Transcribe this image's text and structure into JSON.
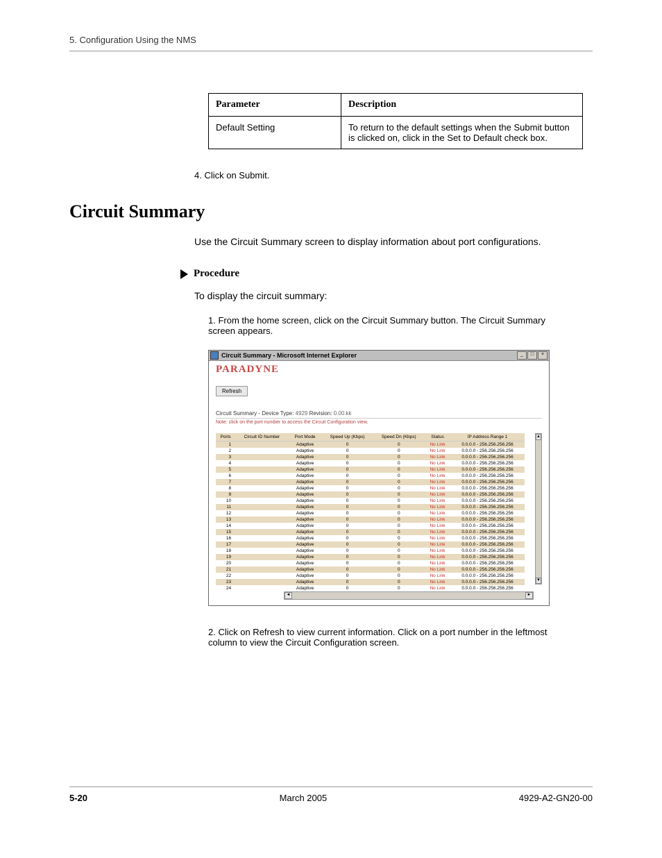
{
  "header": {
    "section": "5.  Configuration Using the NMS"
  },
  "param_table": {
    "h1": "Parameter",
    "h2": "Description",
    "r1c1": "Default Setting",
    "r1c2": "To return to the default settings when the Submit button is clicked on, click in the Set to Default check box."
  },
  "step4": "4.  Click on Submit.",
  "section_title": "Circuit Summary",
  "intro": "Use the Circuit Summary screen to display information about port configurations.",
  "procedure_label": "Procedure",
  "proc_intro": "To display the circuit summary:",
  "step1": "1.  From the home screen, click on the Circuit Summary button. The Circuit Summary screen appears.",
  "screenshot": {
    "title": "Circuit Summary - Microsoft Internet Explorer",
    "brand": "PARADYNE",
    "refresh": "Refresh",
    "device_prefix": "Circuit Summary - Device Type: ",
    "device_type": "4929",
    "rev_prefix": "    Revision: ",
    "revision": "0.00.kk",
    "note": "Note: click on the port number to access the Circuit Configuration view.",
    "columns": [
      "Ports",
      "Circuit ID Number",
      "Port Mode",
      "Speed Up (Kbps)",
      "Speed Dn (Kbps)",
      "Status",
      "IP Address Range 1"
    ],
    "rows": [
      {
        "port": "1",
        "mode": "Adaptive",
        "up": "0",
        "dn": "0",
        "status": "No Link",
        "ip": "0.0.0.0 - 256.256.256.256"
      },
      {
        "port": "2",
        "mode": "Adaptive",
        "up": "0",
        "dn": "0",
        "status": "No Link",
        "ip": "0.0.0.0 - 256.256.256.256"
      },
      {
        "port": "3",
        "mode": "Adaptive",
        "up": "0",
        "dn": "0",
        "status": "No Link",
        "ip": "0.0.0.0 - 256.256.256.256"
      },
      {
        "port": "4",
        "mode": "Adaptive",
        "up": "0",
        "dn": "0",
        "status": "No Link",
        "ip": "0.0.0.0 - 256.256.256.256"
      },
      {
        "port": "5",
        "mode": "Adaptive",
        "up": "0",
        "dn": "0",
        "status": "No Link",
        "ip": "0.0.0.0 - 256.256.256.256"
      },
      {
        "port": "6",
        "mode": "Adaptive",
        "up": "0",
        "dn": "0",
        "status": "No Link",
        "ip": "0.0.0.0 - 256.256.256.256"
      },
      {
        "port": "7",
        "mode": "Adaptive",
        "up": "0",
        "dn": "0",
        "status": "No Link",
        "ip": "0.0.0.0 - 256.256.256.256"
      },
      {
        "port": "8",
        "mode": "Adaptive",
        "up": "0",
        "dn": "0",
        "status": "No Link",
        "ip": "0.0.0.0 - 256.256.256.256"
      },
      {
        "port": "9",
        "mode": "Adaptive",
        "up": "0",
        "dn": "0",
        "status": "No Link",
        "ip": "0.0.0.0 - 256.256.256.256"
      },
      {
        "port": "10",
        "mode": "Adaptive",
        "up": "0",
        "dn": "0",
        "status": "No Link",
        "ip": "0.0.0.0 - 256.256.256.256"
      },
      {
        "port": "11",
        "mode": "Adaptive",
        "up": "0",
        "dn": "0",
        "status": "No Link",
        "ip": "0.0.0.0 - 256.256.256.256"
      },
      {
        "port": "12",
        "mode": "Adaptive",
        "up": "0",
        "dn": "0",
        "status": "No Link",
        "ip": "0.0.0.0 - 256.256.256.256"
      },
      {
        "port": "13",
        "mode": "Adaptive",
        "up": "0",
        "dn": "0",
        "status": "No Link",
        "ip": "0.0.0.0 - 256.256.256.256"
      },
      {
        "port": "14",
        "mode": "Adaptive",
        "up": "0",
        "dn": "0",
        "status": "No Link",
        "ip": "0.0.0.0 - 256.256.256.256"
      },
      {
        "port": "15",
        "mode": "Adaptive",
        "up": "0",
        "dn": "0",
        "status": "No Link",
        "ip": "0.0.0.0 - 256.256.256.256"
      },
      {
        "port": "16",
        "mode": "Adaptive",
        "up": "0",
        "dn": "0",
        "status": "No Link",
        "ip": "0.0.0.0 - 256.256.256.256"
      },
      {
        "port": "17",
        "mode": "Adaptive",
        "up": "0",
        "dn": "0",
        "status": "No Link",
        "ip": "0.0.0.0 - 256.256.256.256"
      },
      {
        "port": "18",
        "mode": "Adaptive",
        "up": "0",
        "dn": "0",
        "status": "No Link",
        "ip": "0.0.0.0 - 256.256.256.256"
      },
      {
        "port": "19",
        "mode": "Adaptive",
        "up": "0",
        "dn": "0",
        "status": "No Link",
        "ip": "0.0.0.0 - 256.256.256.256"
      },
      {
        "port": "20",
        "mode": "Adaptive",
        "up": "0",
        "dn": "0",
        "status": "No Link",
        "ip": "0.0.0.0 - 256.256.256.256"
      },
      {
        "port": "21",
        "mode": "Adaptive",
        "up": "0",
        "dn": "0",
        "status": "No Link",
        "ip": "0.0.0.0 - 256.256.256.256"
      },
      {
        "port": "22",
        "mode": "Adaptive",
        "up": "0",
        "dn": "0",
        "status": "No Link",
        "ip": "0.0.0.0 - 256.256.256.256"
      },
      {
        "port": "23",
        "mode": "Adaptive",
        "up": "0",
        "dn": "0",
        "status": "No Link",
        "ip": "0.0.0.0 - 256.256.256.256"
      },
      {
        "port": "24",
        "mode": "Adaptive",
        "up": "0",
        "dn": "0",
        "status": "No Link",
        "ip": "0.0.0.0 - 256.256.256.256"
      }
    ]
  },
  "step2": "2.  Click on Refresh to view current information. Click on a port number in the leftmost column to view the Circuit Configuration screen.",
  "footer": {
    "page": "5-20",
    "date": "March 2005",
    "doc": "4929-A2-GN20-00"
  }
}
